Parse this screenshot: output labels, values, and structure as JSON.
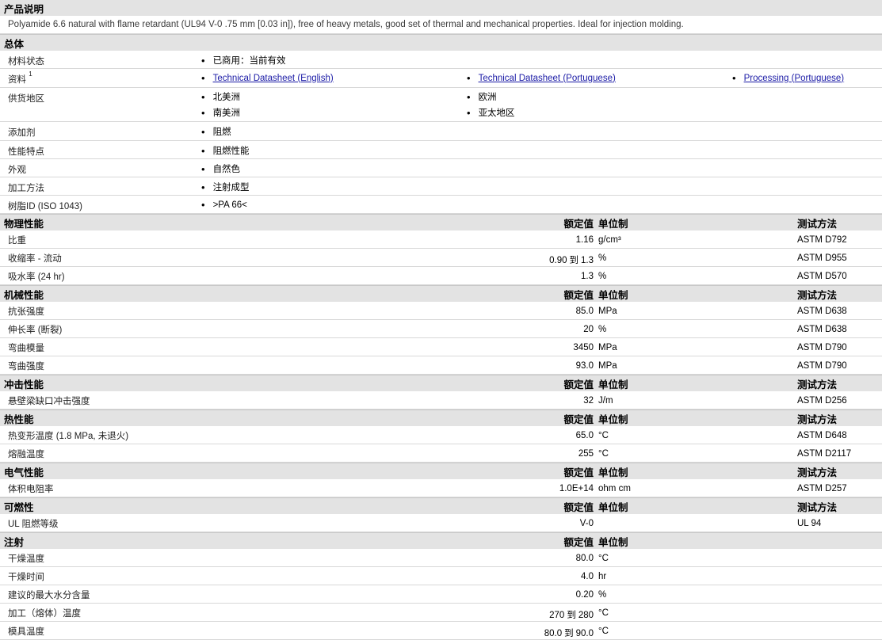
{
  "product_desc": {
    "heading": "产品说明",
    "text": "Polyamide 6.6 natural with flame retardant (UL94 V-0 .75 mm [0.03 in]), free of heavy metals, good set of thermal and mechanical properties. Ideal for injection molding."
  },
  "general": {
    "heading": "总体",
    "material_status": {
      "label": "材料状态",
      "value": "已商用：当前有效"
    },
    "documents": {
      "label": "资料",
      "sup": "1",
      "links": [
        "Technical Datasheet (English)",
        "Technical Datasheet (Portuguese)",
        "Processing (Portuguese)"
      ]
    },
    "availability": {
      "label": "供货地区",
      "regions": [
        "北美洲",
        "欧洲",
        "南美洲",
        "亚太地区"
      ]
    },
    "additive": {
      "label": "添加剂",
      "value": "阻燃"
    },
    "features": {
      "label": "性能特点",
      "value": "阻燃性能"
    },
    "appearance": {
      "label": "外观",
      "value": "自然色"
    },
    "processing": {
      "label": "加工方法",
      "value": "注射成型"
    },
    "resin_id": {
      "label": "树脂ID (ISO 1043)",
      "value": ">PA 66<"
    }
  },
  "col_headers": {
    "nominal": "额定值",
    "unit": "单位制",
    "test": "测试方法"
  },
  "sections": [
    {
      "title": "物理性能",
      "show_test": true,
      "rows": [
        {
          "label": "比重",
          "nominal": "1.16",
          "unit": "g/cm³",
          "test": "ASTM D792"
        },
        {
          "label": "收缩率 - 流动",
          "nominal_from": "0.90",
          "to": "到",
          "nominal_to": "1.3",
          "unit": "%",
          "test": "ASTM D955"
        },
        {
          "label": "吸水率 (24 hr)",
          "nominal": "1.3",
          "unit": "%",
          "test": "ASTM D570"
        }
      ]
    },
    {
      "title": "机械性能",
      "show_test": true,
      "rows": [
        {
          "label": "抗张强度",
          "nominal": "85.0",
          "unit": "MPa",
          "test": "ASTM D638"
        },
        {
          "label": "伸长率 (断裂)",
          "nominal": "20",
          "unit": "%",
          "test": "ASTM D638"
        },
        {
          "label": "弯曲模量",
          "nominal": "3450",
          "unit": "MPa",
          "test": "ASTM D790"
        },
        {
          "label": "弯曲强度",
          "nominal": "93.0",
          "unit": "MPa",
          "test": "ASTM D790"
        }
      ]
    },
    {
      "title": "冲击性能",
      "show_test": true,
      "rows": [
        {
          "label": "悬壁梁缺口冲击强度",
          "nominal": "32",
          "unit": "J/m",
          "test": "ASTM D256"
        }
      ]
    },
    {
      "title": "热性能",
      "show_test": true,
      "rows": [
        {
          "label": "热变形温度 (1.8 MPa, 未退火)",
          "nominal": "65.0",
          "unit": "°C",
          "test": "ASTM D648"
        },
        {
          "label": "熔融温度",
          "nominal": "255",
          "unit": "°C",
          "test": "ASTM D2117"
        }
      ]
    },
    {
      "title": "电气性能",
      "show_test": true,
      "rows": [
        {
          "label": "体积电阻率",
          "nominal": "1.0E+14",
          "unit": "ohm cm",
          "test": "ASTM D257"
        }
      ]
    },
    {
      "title": "可燃性",
      "show_test": true,
      "rows": [
        {
          "label": "UL 阻燃等级",
          "nominal": "V-0",
          "unit": "",
          "test": "UL 94"
        }
      ]
    },
    {
      "title": "注射",
      "show_test": false,
      "rows": [
        {
          "label": "干燥温度",
          "nominal": "80.0",
          "unit": "°C",
          "test": ""
        },
        {
          "label": "干燥时间",
          "nominal": "4.0",
          "unit": "hr",
          "test": ""
        },
        {
          "label": "建议的最大水分含量",
          "nominal": "0.20",
          "unit": "%",
          "test": ""
        },
        {
          "label": "加工（熔体）温度",
          "nominal_from": "270",
          "to": "到",
          "nominal_to": "280",
          "unit": "°C",
          "test": ""
        },
        {
          "label": "模具温度",
          "nominal_from": "80.0",
          "to": "到",
          "nominal_to": "90.0",
          "unit": "°C",
          "test": ""
        }
      ]
    }
  ]
}
